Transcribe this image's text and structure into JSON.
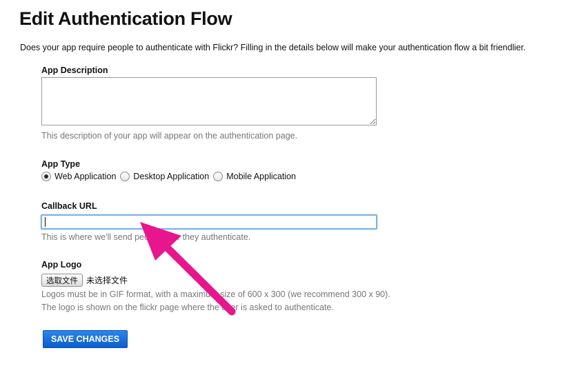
{
  "page": {
    "title": "Edit Authentication Flow",
    "intro": "Does your app require people to authenticate with Flickr? Filling in the details below will make your authentication flow a bit friendlier."
  },
  "app_description": {
    "label": "App Description",
    "value": "",
    "hint": "This description of your app will appear on the authentication page."
  },
  "app_type": {
    "label": "App Type",
    "options": [
      {
        "label": "Web Application",
        "selected": true
      },
      {
        "label": "Desktop Application",
        "selected": false
      },
      {
        "label": "Mobile Application",
        "selected": false
      }
    ]
  },
  "callback_url": {
    "label": "Callback URL",
    "value": "",
    "hint": "This is where we'll send people after they authenticate."
  },
  "app_logo": {
    "label": "App Logo",
    "button_label": "选取文件",
    "file_status": "未选择文件",
    "hint_line1": "Logos must be in GIF format, with a maximum size of 600 x 300 (we recommend 300 x 90).",
    "hint_line2": "The logo is shown on the flickr page where the user is asked to authenticate."
  },
  "actions": {
    "save_label": "SAVE CHANGES"
  },
  "colors": {
    "annotation_arrow": "#e8168c",
    "save_button": "#0b5ed0",
    "hint_text": "#777777",
    "focus_ring": "#7fb2e6"
  },
  "icons": {
    "annotation": "arrow-pointer-icon"
  }
}
